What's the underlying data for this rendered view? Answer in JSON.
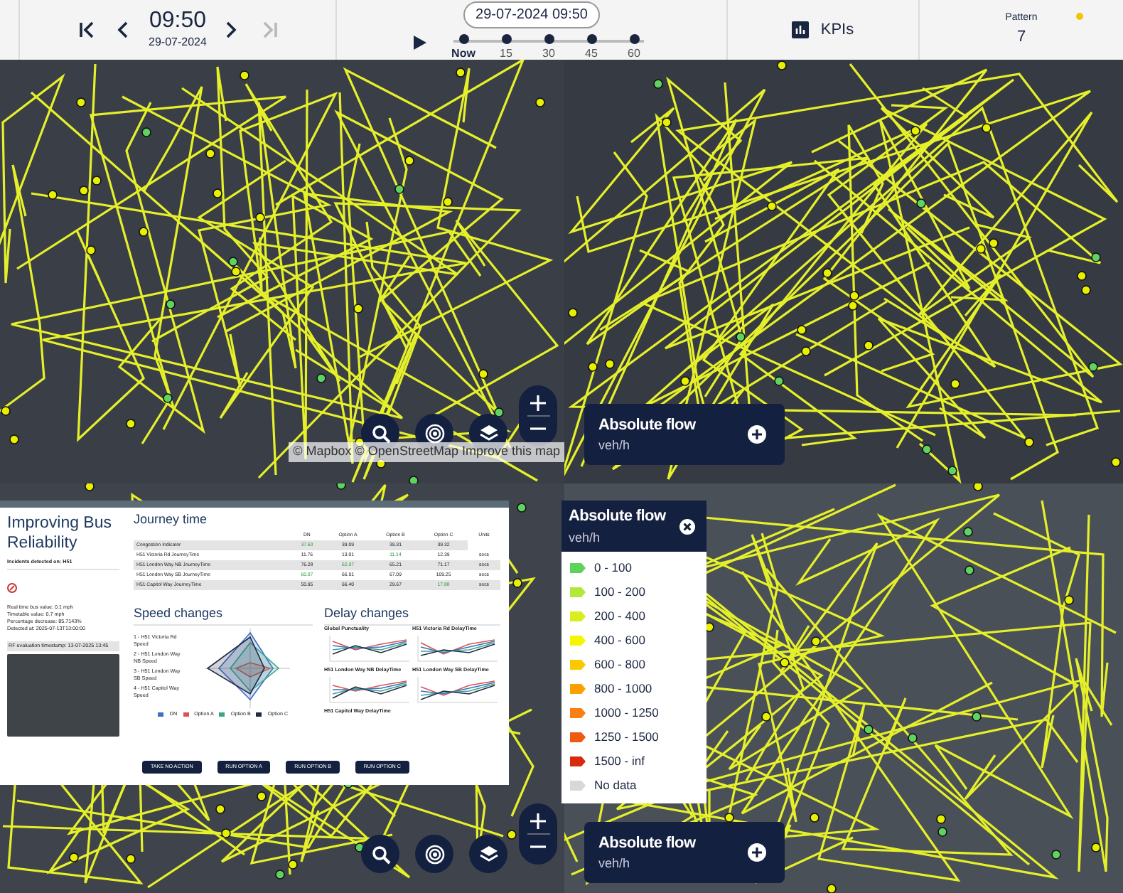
{
  "top_bar": {
    "nav_buttons": [
      {
        "kind": "first",
        "disabled": false
      },
      {
        "kind": "prev",
        "disabled": false
      },
      {
        "kind": "next",
        "disabled": false
      },
      {
        "kind": "last",
        "disabled": true
      }
    ],
    "time": "09:50",
    "date": "29-07-2024",
    "timeline": {
      "current": "29-07-2024 09:50",
      "ticks": [
        {
          "label": "Now",
          "selected": true
        },
        {
          "label": "15",
          "selected": false
        },
        {
          "label": "30",
          "selected": false
        },
        {
          "label": "45",
          "selected": false
        },
        {
          "label": "60",
          "selected": false
        }
      ]
    },
    "kpis": "KPIs",
    "pattern": {
      "label": "Pattern",
      "value": "7",
      "alert": true
    }
  },
  "map_attribution": "© Mapbox © OpenStreetMap Improve this map",
  "flow_cards": [
    {
      "title": "Absolute flow",
      "unit": "veh/h"
    },
    {
      "title": "Absolute flow",
      "unit": "veh/h"
    }
  ],
  "legend": {
    "title": "Absolute flow",
    "unit": "veh/h",
    "items": [
      {
        "label": "0 - 100",
        "color": "#5ed35c"
      },
      {
        "label": "100 - 200",
        "color": "#b3e83a"
      },
      {
        "label": "200 - 400",
        "color": "#d8ee1e"
      },
      {
        "label": "400 - 600",
        "color": "#f6f500"
      },
      {
        "label": "600 - 800",
        "color": "#fcc800"
      },
      {
        "label": "800 - 1000",
        "color": "#fca000"
      },
      {
        "label": "1000 - 1250",
        "color": "#f98012"
      },
      {
        "label": "1250 - 1500",
        "color": "#f05a10"
      },
      {
        "label": "1500 - inf",
        "color": "#d92a10"
      },
      {
        "label": "No data",
        "color": "#d8d8d8"
      }
    ]
  },
  "dashboard": {
    "title": "Improving Bus Reliability",
    "incidents_heading": "Incidents detected on: H51",
    "details": [
      "Real time bus value: 0.1 mph",
      "Timetable value: 0.7 mph",
      "Percentage decrease: 85.7143%",
      "Detected at: 2025-07-13T13:00:00"
    ],
    "timestamp": "RF evaluation timestamp: 13-07-2025 13:45",
    "journey_time": {
      "title": "Journey time",
      "columns": [
        "DN",
        "Option A",
        "Option B",
        "Option C",
        "Units"
      ],
      "rows": [
        {
          "name": "Congestion Indicator",
          "cells": [
            {
              "text": "37.60",
              "best": true
            },
            {
              "text": "39.09",
              "best": false
            },
            {
              "text": "39.31",
              "best": false
            },
            {
              "text": "39.32",
              "best": false
            }
          ]
        },
        {
          "name": "H51 Victoria Rd JourneyTime",
          "cells": [
            {
              "text": "11.76",
              "best": false
            },
            {
              "text": "13.01",
              "best": false
            },
            {
              "text": "11.14",
              "best": true
            },
            {
              "text": "12.39",
              "best": false
            },
            {
              "text": "secs",
              "best": false
            }
          ]
        },
        {
          "name": "H51 London Way NB JourneyTime",
          "cells": [
            {
              "text": "76.28",
              "best": false
            },
            {
              "text": "62.97",
              "best": true
            },
            {
              "text": "65.21",
              "best": false
            },
            {
              "text": "71.17",
              "best": false
            },
            {
              "text": "secs",
              "best": false
            }
          ]
        },
        {
          "name": "H51 London Way SB JourneyTime",
          "cells": [
            {
              "text": "60.07",
              "best": true
            },
            {
              "text": "66.91",
              "best": false
            },
            {
              "text": "67.09",
              "best": false
            },
            {
              "text": "109.25",
              "best": false
            },
            {
              "text": "secs",
              "best": false
            }
          ]
        },
        {
          "name": "H51 Capitol Way JourneyTime",
          "cells": [
            {
              "text": "50.95",
              "best": false
            },
            {
              "text": "66.40",
              "best": false
            },
            {
              "text": "29.67",
              "best": false
            },
            {
              "text": "17.88",
              "best": true
            },
            {
              "text": "secs",
              "best": false
            }
          ]
        }
      ]
    },
    "speed_changes": {
      "title": "Speed changes",
      "axes": [
        "1 - H51 Victoria Rd Speed",
        "2 - H51 London Way NB Speed",
        "3 - H51 London Way SB Speed",
        "4 - H51 Capitol Way Speed"
      ],
      "series": [
        {
          "name": "DN",
          "color": "#3b6fc4"
        },
        {
          "name": "Option A",
          "color": "#d9534f"
        },
        {
          "name": "Option B",
          "color": "#3aa58a"
        },
        {
          "name": "Option C",
          "color": "#1f2a44"
        }
      ]
    },
    "delay_changes": {
      "title": "Delay changes",
      "panels": [
        "Global Punctuality",
        "H51 Victoria Rd DelayTime",
        "H51 London Way NB DelayTime",
        "H51 London Way SB DelayTime",
        "H51 Capitol Way DelayTime"
      ]
    },
    "buttons": [
      "TAKE NO ACTION",
      "RUN OPTION A",
      "RUN OPTION B",
      "RUN OPTION C"
    ]
  }
}
